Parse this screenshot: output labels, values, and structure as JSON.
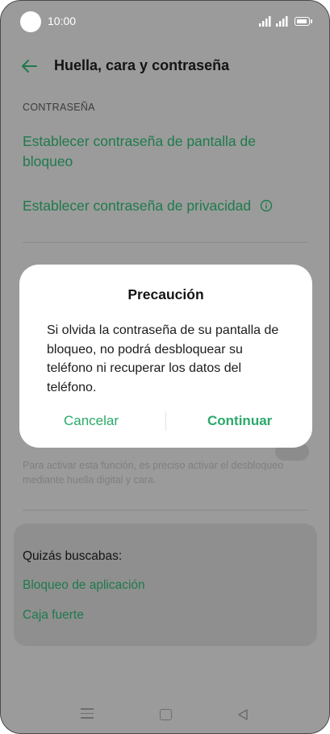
{
  "status_bar": {
    "time": "10:00"
  },
  "header": {
    "title": "Huella, cara y contraseña"
  },
  "password_section": {
    "label": "CONTRASEÑA",
    "items": [
      {
        "label": "Establecer contraseña de pantalla de bloqueo"
      },
      {
        "label": "Establecer contraseña de privacidad"
      }
    ]
  },
  "biometric_section": {
    "hint": "Para activar esta función, es preciso activar el desbloqueo mediante huella digital y cara."
  },
  "suggestions": {
    "title": "Quizás buscabas:",
    "items": [
      "Bloqueo de aplicación",
      "Caja fuerte"
    ]
  },
  "dialog": {
    "title": "Precaución",
    "message": "Si olvida la contraseña de su pantalla de bloqueo, no podrá desbloquear su teléfono ni recuperar los datos del teléfono.",
    "cancel_label": "Cancelar",
    "continue_label": "Continuar"
  },
  "colors": {
    "accent": "#2aaa6a",
    "accent_dimmed": "#1e7a4c",
    "scrim": "#9b9b9b"
  },
  "icons": [
    "back-arrow-icon",
    "info-icon",
    "menu-icon",
    "home-icon",
    "back-icon",
    "signal-icon",
    "battery-icon"
  ]
}
